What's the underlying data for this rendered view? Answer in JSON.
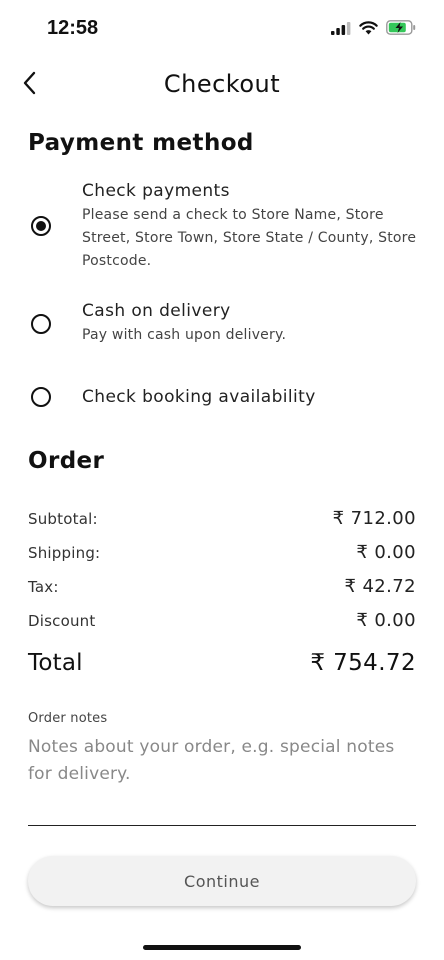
{
  "status_bar": {
    "time": "12:58",
    "icons": [
      "cellular-signal-icon",
      "wifi-icon",
      "battery-charging-icon"
    ],
    "battery_color": "#34c759"
  },
  "header": {
    "title": "Checkout",
    "back_icon": "chevron-left-icon"
  },
  "payment": {
    "section_title": "Payment method",
    "options": [
      {
        "label": "Check payments",
        "description": "Please send a check to Store Name, Store Street, Store Town, Store State / County, Store Postcode.",
        "selected": true
      },
      {
        "label": "Cash on delivery",
        "description": "Pay with cash upon delivery.",
        "selected": false
      },
      {
        "label": "Check booking availability",
        "description": "",
        "selected": false
      }
    ]
  },
  "order": {
    "section_title": "Order",
    "rows": [
      {
        "label": "Subtotal:",
        "value": "₹ 712.00"
      },
      {
        "label": "Shipping:",
        "value": "₹ 0.00"
      },
      {
        "label": "Tax:",
        "value": "₹ 42.72"
      },
      {
        "label": "Discount",
        "value": "₹ 0.00"
      }
    ],
    "total_label": "Total",
    "total_value": "₹ 754.72"
  },
  "notes": {
    "label": "Order notes",
    "placeholder": "Notes about your order, e.g. special notes for delivery.",
    "value": ""
  },
  "actions": {
    "continue_label": "Continue"
  }
}
